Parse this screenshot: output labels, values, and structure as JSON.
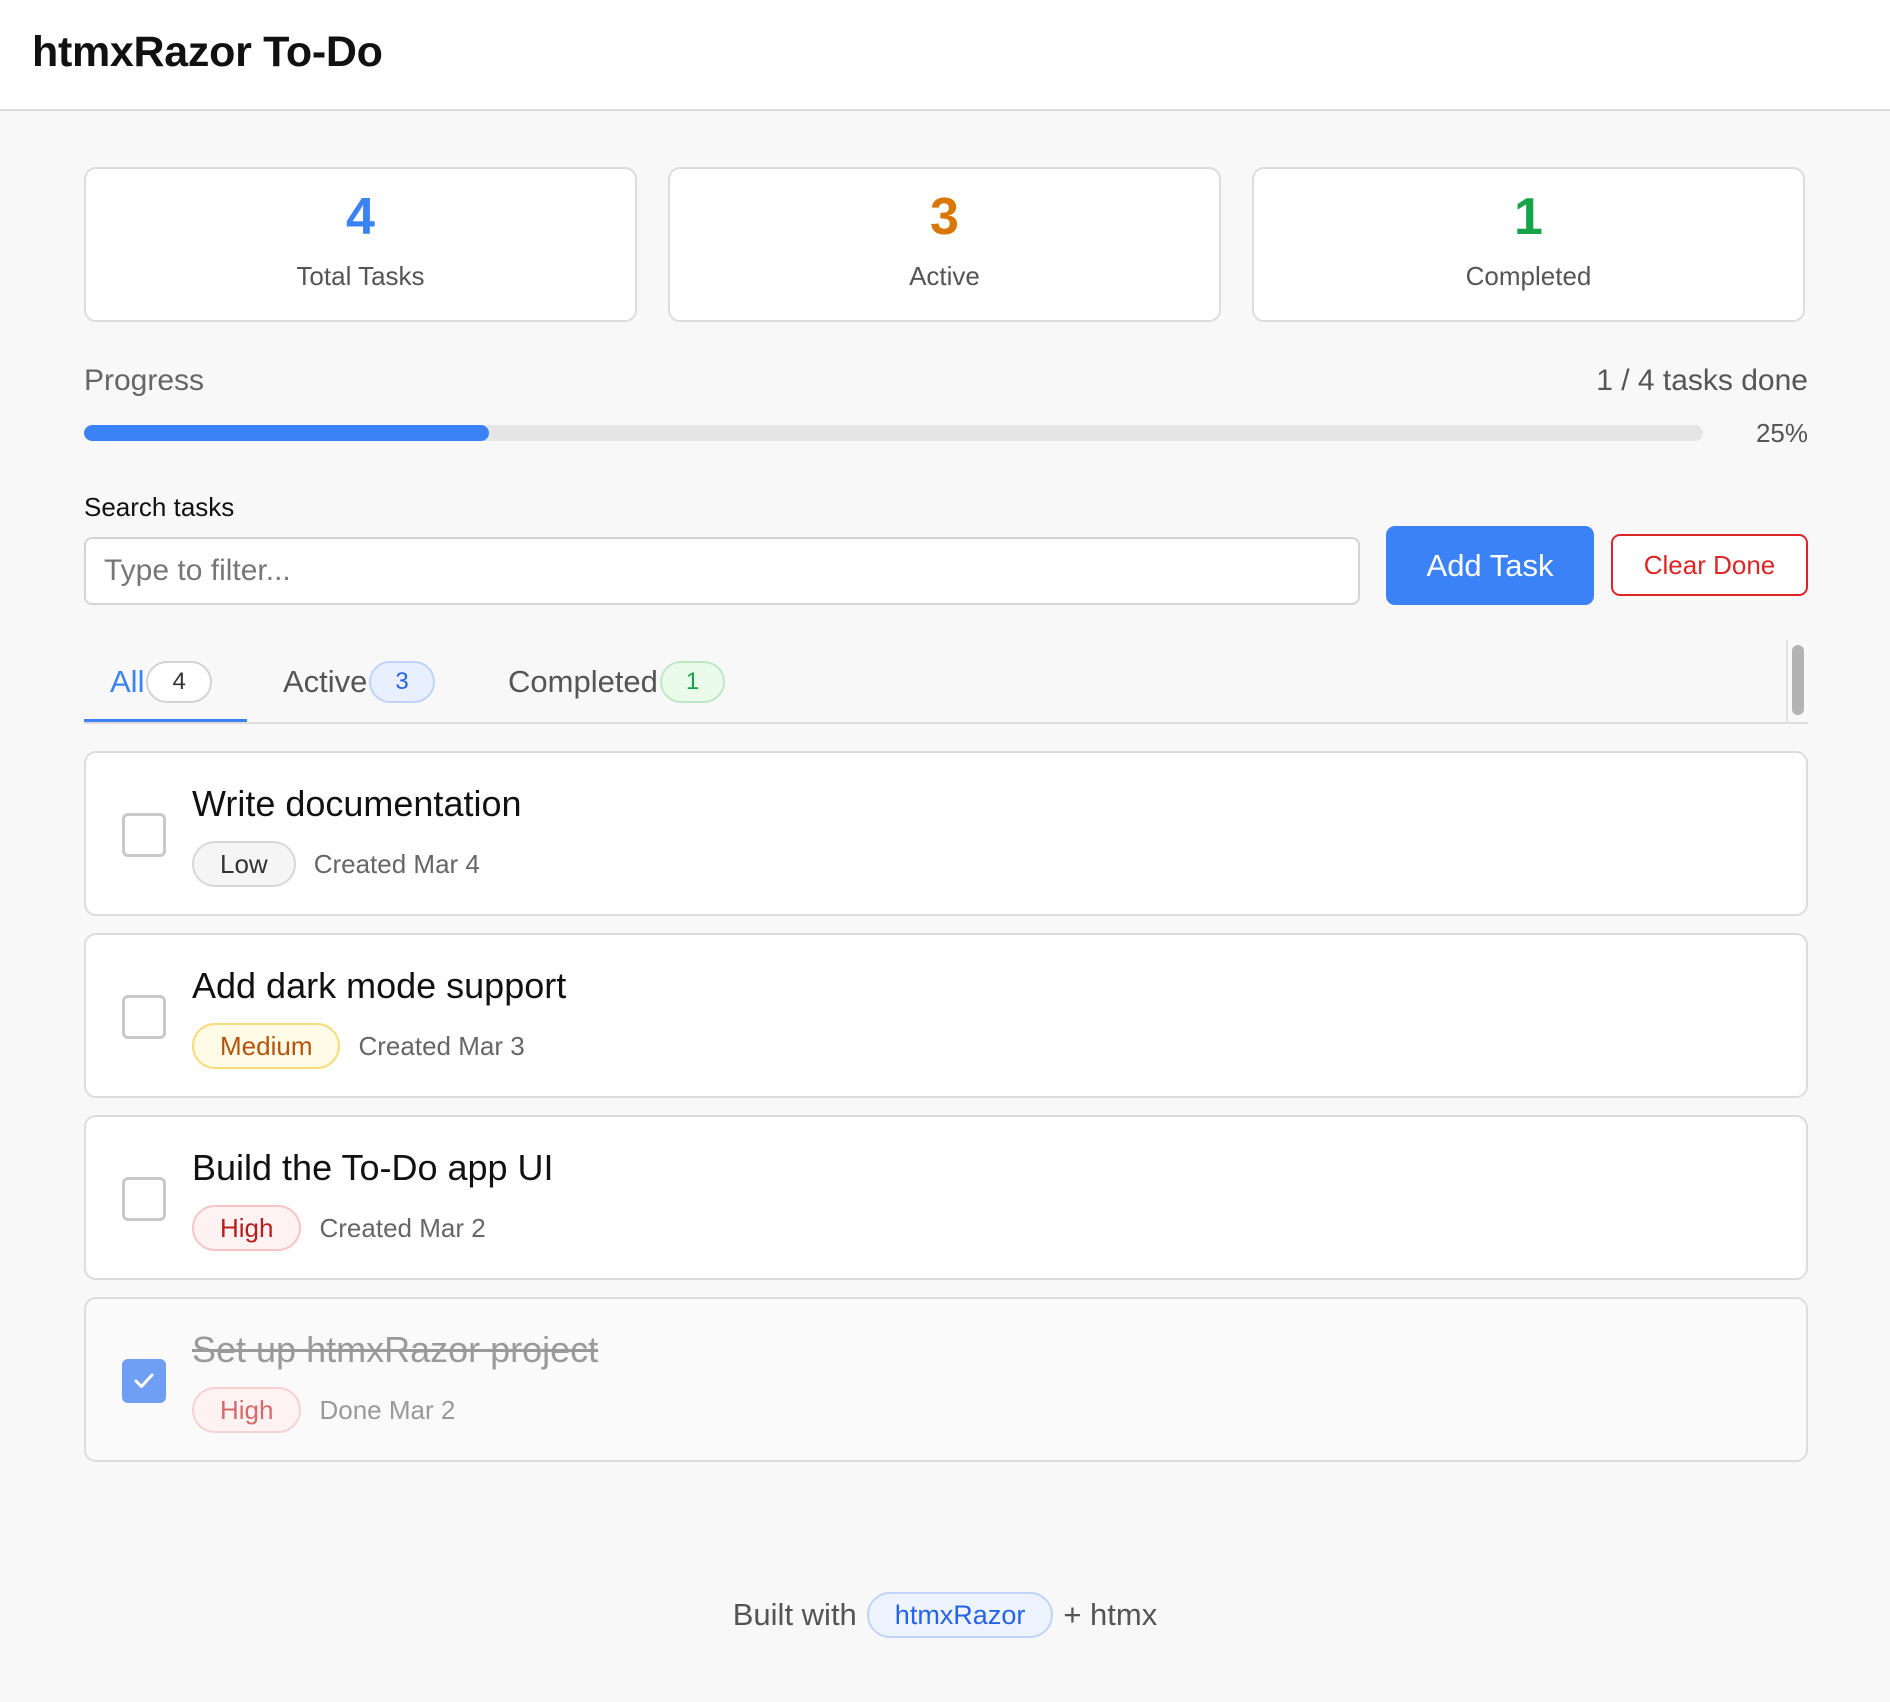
{
  "app": {
    "title": "htmxRazor To-Do"
  },
  "stats": [
    {
      "value": "4",
      "label": "Total Tasks",
      "color": "#3b82f6"
    },
    {
      "value": "3",
      "label": "Active",
      "color": "#d97706"
    },
    {
      "value": "1",
      "label": "Completed",
      "color": "#16a34a"
    }
  ],
  "progress": {
    "label": "Progress",
    "count_text": "1 / 4 tasks done",
    "percent_text": "25%",
    "fraction": 0.25
  },
  "search": {
    "label": "Search tasks",
    "placeholder": "Type to filter...",
    "value": ""
  },
  "buttons": {
    "add": "Add Task",
    "clear": "Clear Done"
  },
  "tabs": [
    {
      "label": "All",
      "count": "4",
      "active": true
    },
    {
      "label": "Active",
      "count": "3",
      "active": false
    },
    {
      "label": "Completed",
      "count": "1",
      "active": false
    }
  ],
  "tasks": [
    {
      "title": "Write documentation",
      "priority": "Low",
      "date": "Created Mar 4",
      "done": false
    },
    {
      "title": "Add dark mode support",
      "priority": "Medium",
      "date": "Created Mar 3",
      "done": false
    },
    {
      "title": "Build the To-Do app UI",
      "priority": "High",
      "date": "Created Mar 2",
      "done": false
    },
    {
      "title": "Set up htmxRazor project",
      "priority": "High",
      "date": "Done Mar 2",
      "done": true
    }
  ],
  "footer": {
    "prefix": "Built with",
    "brand": "htmxRazor",
    "suffix": "+ htmx"
  },
  "icons": {
    "check": "checkmark-icon"
  }
}
